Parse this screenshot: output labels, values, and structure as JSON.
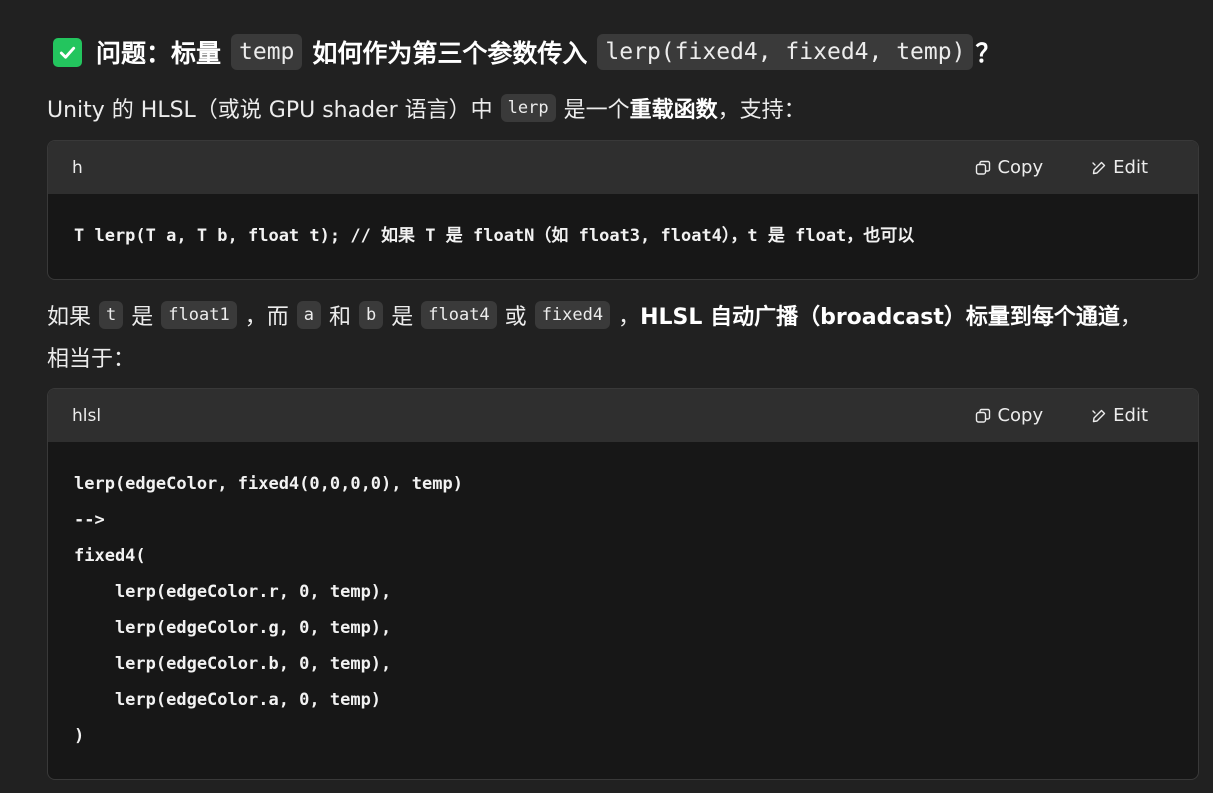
{
  "heading": {
    "prefix": "问题：标量",
    "code1": "temp",
    "middle": "如何作为第三个参数传入",
    "code2": "lerp(fixed4, fixed4, temp)",
    "suffix": "？"
  },
  "para1": {
    "text1": "Unity 的 HLSL（或说 GPU shader 语言）中",
    "code": "lerp",
    "text2": "是一个",
    "bold": "重载函数",
    "text3": "，支持："
  },
  "code_block_1": {
    "language": "h",
    "copy_label": "Copy",
    "edit_label": "Edit",
    "lines": [
      "T lerp(T a, T b, float t); // 如果 T 是 floatN（如 float3, float4），t 是 float，也可以"
    ]
  },
  "para2": {
    "t1": "如果",
    "c1": "t",
    "t2": "是",
    "c2": "float1",
    "t3": "，而",
    "c3": "a",
    "t4": "和",
    "c4": "b",
    "t5": "是",
    "c5": "float4",
    "t6": "或",
    "c6": "fixed4",
    "t7": "，",
    "bold": "HLSL 自动广播（broadcast）标量到每个通道",
    "t8": "，",
    "line2": "相当于："
  },
  "code_block_2": {
    "language": "hlsl",
    "copy_label": "Copy",
    "edit_label": "Edit",
    "lines": [
      "lerp(edgeColor, fixed4(0,0,0,0), temp)",
      "-->",
      "fixed4(",
      "    lerp(edgeColor.r, 0, temp),",
      "    lerp(edgeColor.g, 0, temp),",
      "    lerp(edgeColor.b, 0, temp),",
      "    lerp(edgeColor.a, 0, temp)",
      ")"
    ]
  },
  "icons": {
    "check": "check-box-icon",
    "copy": "copy-icon",
    "edit": "edit-pencil-icon"
  },
  "colors": {
    "background": "#212121",
    "check_green": "#23c55e",
    "inline_code_bg": "#3a3a3a",
    "code_header_bg": "#2f2f2f",
    "code_body_bg": "#171717"
  }
}
